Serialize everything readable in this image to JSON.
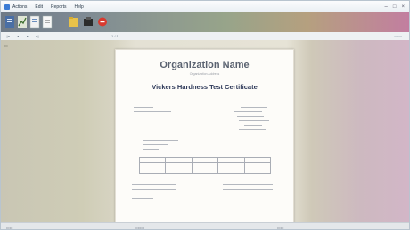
{
  "menu": {
    "items": [
      "Actions",
      "Edit",
      "Reports",
      "Help"
    ]
  },
  "toolbar": {
    "tools": [
      {
        "name": "new-document-icon",
        "color": "#4a6fa5"
      },
      {
        "name": "chart-icon",
        "color": "#5c8a4a"
      },
      {
        "name": "open-file-icon",
        "color": "#e8e8e8"
      },
      {
        "name": "document-icon",
        "color": "#f0f0f0"
      },
      {
        "name": "folder-icon",
        "color": "#e8c24a"
      },
      {
        "name": "printer-icon",
        "color": "#2b2b2b"
      },
      {
        "name": "stop-icon",
        "color": "#d93a2f"
      }
    ]
  },
  "navbar": {
    "page_indicator": "1 / 1"
  },
  "certificate": {
    "organization_name": "Organization Name",
    "organization_sub": "Organization Address",
    "title": "Vickers Hardness Test Certificate"
  },
  "colors": {
    "title": "#2f3a5a",
    "org_name": "#5a6270"
  }
}
